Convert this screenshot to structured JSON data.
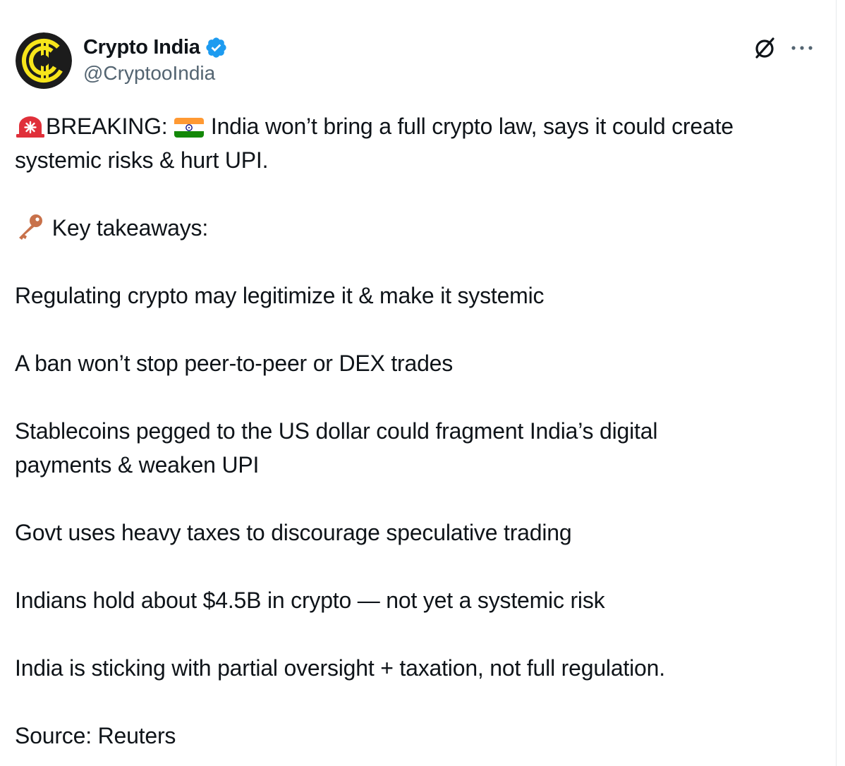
{
  "tweet": {
    "author": {
      "display_name": "Crypto India",
      "handle": "@CryptooIndia",
      "verified_icon": "verified-badge-icon",
      "avatar_icon": "crypto-india-logo"
    },
    "actions": {
      "grok_icon": "grok-icon",
      "more_icon": "more-options-icon"
    },
    "lines": {
      "breaking_label": "BREAKING:",
      "breaking_text": "India won’t bring a full crypto law, says it could create",
      "breaking_text_2": "systemic risks & hurt UPI.",
      "takeaways_label": "Key takeaways:",
      "point1": "Regulating crypto may legitimize it & make it systemic",
      "point2": "A ban won’t stop peer-to-peer or DEX trades",
      "point3_a": "Stablecoins pegged to the US dollar could fragment India’s digital",
      "point3_b": "payments & weaken UPI",
      "point4": "Govt uses heavy taxes to discourage speculative trading",
      "point5": "Indians hold about $4.5B in crypto — not yet a systemic risk",
      "point6": "India is sticking with partial oversight + taxation, not full regulation.",
      "source": "Source: Reuters"
    },
    "emojis": {
      "siren": "police-light-emoji",
      "flag": "india-flag-emoji",
      "key": "key-emoji"
    },
    "colors": {
      "text": "#0f1419",
      "secondary": "#536471",
      "verified_blue": "#1d9bf0",
      "logo_yellow": "#f7e51b"
    }
  }
}
